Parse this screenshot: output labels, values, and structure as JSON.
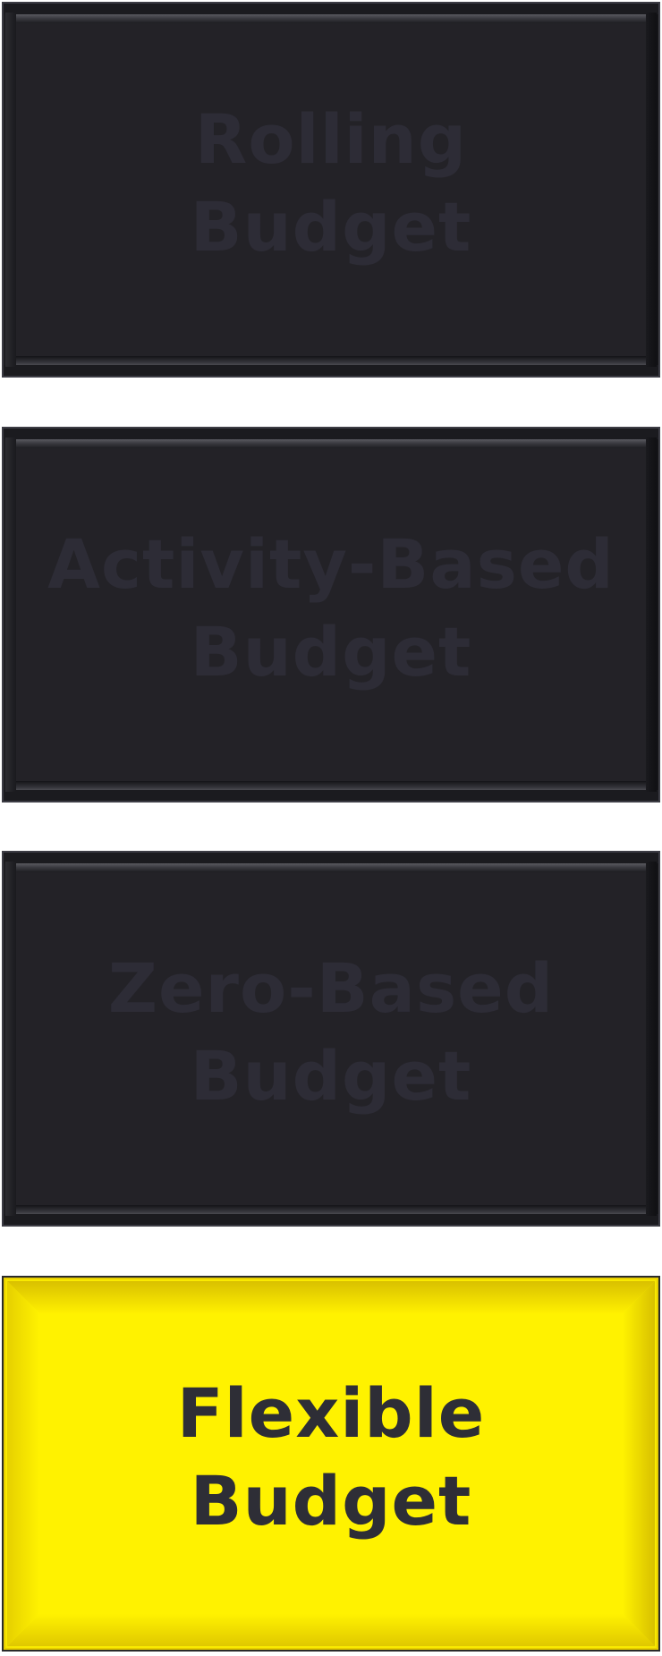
{
  "options": [
    {
      "line1": "Rolling",
      "line2": "Budget",
      "selected": false
    },
    {
      "line1": "Activity-Based",
      "line2": "Budget",
      "selected": false
    },
    {
      "line1": "Zero-Based",
      "line2": "Budget",
      "selected": false
    },
    {
      "line1": "Flexible",
      "line2": "Budget",
      "selected": true
    }
  ],
  "colors": {
    "dark_tile": "#232227",
    "dark_text": "#2d2c36",
    "selected_tile": "#fff200",
    "selected_text": "#2e2e36"
  }
}
